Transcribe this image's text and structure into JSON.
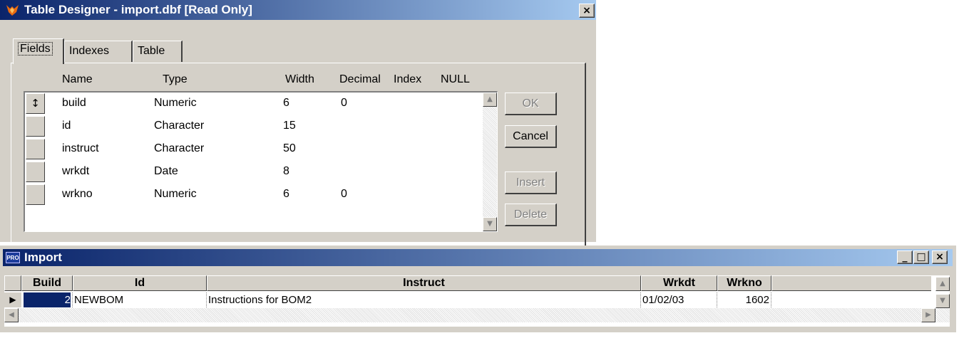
{
  "designer": {
    "title": "Table Designer - import.dbf [Read Only]",
    "close_glyph": "×",
    "tabs": [
      {
        "label": "Fields",
        "active": true
      },
      {
        "label": "Indexes",
        "active": false
      },
      {
        "label": "Table",
        "active": false
      }
    ],
    "columns": [
      "Name",
      "Type",
      "Width",
      "Decimal",
      "Index",
      "NULL"
    ],
    "fields": [
      {
        "name": "build",
        "type": "Numeric",
        "width": "6",
        "decimal": "0",
        "selector": "↕"
      },
      {
        "name": "id",
        "type": "Character",
        "width": "15",
        "decimal": "",
        "selector": ""
      },
      {
        "name": "instruct",
        "type": "Character",
        "width": "50",
        "decimal": "",
        "selector": ""
      },
      {
        "name": "wrkdt",
        "type": "Date",
        "width": "8",
        "decimal": "",
        "selector": ""
      },
      {
        "name": "wrkno",
        "type": "Numeric",
        "width": "6",
        "decimal": "0",
        "selector": ""
      }
    ],
    "buttons": {
      "ok": "OK",
      "cancel": "Cancel",
      "insert": "Insert",
      "delete": "Delete"
    }
  },
  "import": {
    "title": "Import",
    "icon_text": "PRO",
    "window_controls": {
      "minimize": "_",
      "maximize": "□",
      "close": "×"
    },
    "columns": [
      "Build",
      "Id",
      "Instruct",
      "Wrkdt",
      "Wrkno"
    ],
    "rows": [
      {
        "build": "2",
        "id": "NEWBOM",
        "instruct": "Instructions for BOM2",
        "wrkdt": "01/02/03",
        "wrkno": "1602"
      }
    ],
    "row_pointer": "▶"
  },
  "colors": {
    "titlebar_start": "#0a246a",
    "titlebar_end": "#a6caf0",
    "face": "#d4d0c8",
    "selection": "#0a246a"
  }
}
